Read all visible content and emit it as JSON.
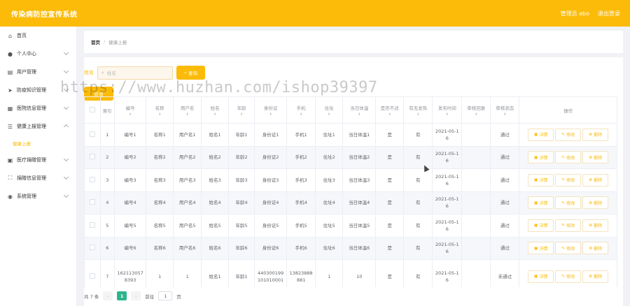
{
  "header": {
    "title": "传染病防控宣传系统",
    "user_label": "管理员 abo",
    "logout_label": "退出登录"
  },
  "sidebar": {
    "items": [
      {
        "label": "首页",
        "icon": "home-icon",
        "has_arrow": false
      },
      {
        "label": "个人中心",
        "icon": "user-icon",
        "has_arrow": true
      },
      {
        "label": "用户管理",
        "icon": "users-icon",
        "has_arrow": true
      },
      {
        "label": "防疫知识管理",
        "icon": "send-icon",
        "has_arrow": true
      },
      {
        "label": "医院信息管理",
        "icon": "grid-icon",
        "has_arrow": true
      },
      {
        "label": "健康上报管理",
        "icon": "list-icon",
        "has_arrow": true,
        "expanded": true
      },
      {
        "label": "医疗捐赠管理",
        "icon": "box-icon",
        "has_arrow": true
      },
      {
        "label": "捐赠信息管理",
        "icon": "frame-icon",
        "has_arrow": true
      },
      {
        "label": "系统管理",
        "icon": "pin-icon",
        "has_arrow": true
      }
    ],
    "subitem": "健康上报"
  },
  "breadcrumb": {
    "home": "首页",
    "current": "健康上报"
  },
  "search": {
    "label": "姓名",
    "placeholder": "姓名",
    "search_button": "查询",
    "add_button": "新增"
  },
  "watermark": "https://www.huzhan.com/ishop39397",
  "table": {
    "columns": [
      "索引",
      "编号",
      "名称",
      "用户名",
      "姓名",
      "年龄",
      "身份证",
      "手机",
      "住址",
      "当日体温",
      "是否不适",
      "有无发热",
      "发布时间",
      "审核回复",
      "审核状态",
      "操作"
    ],
    "rows": [
      {
        "idx": "1",
        "code": "编号1",
        "name": "名称1",
        "username": "用户名1",
        "realname": "姓名1",
        "age": "年龄1",
        "idcard": "身份证1",
        "phone": "手机1",
        "address": "住址1",
        "temp": "当日体温1",
        "unwell": "是",
        "fever": "有",
        "date": "2021-05-16",
        "reply": "",
        "status": "通过"
      },
      {
        "idx": "2",
        "code": "编号2",
        "name": "名称2",
        "username": "用户名2",
        "realname": "姓名2",
        "age": "年龄2",
        "idcard": "身份证2",
        "phone": "手机2",
        "address": "住址2",
        "temp": "当日体温2",
        "unwell": "是",
        "fever": "有",
        "date": "2021-05-16",
        "reply": "",
        "status": "通过"
      },
      {
        "idx": "3",
        "code": "编号3",
        "name": "名称3",
        "username": "用户名3",
        "realname": "姓名3",
        "age": "年龄3",
        "idcard": "身份证3",
        "phone": "手机3",
        "address": "住址3",
        "temp": "当日体温3",
        "unwell": "是",
        "fever": "有",
        "date": "2021-05-16",
        "reply": "",
        "status": "通过"
      },
      {
        "idx": "4",
        "code": "编号4",
        "name": "名称4",
        "username": "用户名4",
        "realname": "姓名4",
        "age": "年龄4",
        "idcard": "身份证4",
        "phone": "手机4",
        "address": "住址4",
        "temp": "当日体温4",
        "unwell": "是",
        "fever": "有",
        "date": "2021-05-16",
        "reply": "",
        "status": "通过"
      },
      {
        "idx": "5",
        "code": "编号5",
        "name": "名称5",
        "username": "用户名5",
        "realname": "姓名5",
        "age": "年龄5",
        "idcard": "身份证5",
        "phone": "手机5",
        "address": "住址5",
        "temp": "当日体温5",
        "unwell": "是",
        "fever": "有",
        "date": "2021-05-16",
        "reply": "",
        "status": "通过"
      },
      {
        "idx": "6",
        "code": "编号6",
        "name": "名称6",
        "username": "用户名6",
        "realname": "姓名6",
        "age": "年龄6",
        "idcard": "身份证6",
        "phone": "手机6",
        "address": "住址6",
        "temp": "当日体温6",
        "unwell": "是",
        "fever": "有",
        "date": "2021-05-16",
        "reply": "",
        "status": "通过"
      },
      {
        "idx": "7",
        "code": "1621130578393",
        "name": "1",
        "username": "1",
        "realname": "姓名1",
        "age": "年龄1",
        "idcard": "440300199101010001",
        "phone": "13823888881",
        "address": "1",
        "temp": "10",
        "unwell": "是",
        "fever": "有",
        "date": "2021-05-16",
        "reply": "",
        "status": "未通过"
      }
    ],
    "actions": {
      "detail": "详情",
      "edit": "修改",
      "delete": "删除"
    }
  },
  "pagination": {
    "total": "共 7 条",
    "current_page": "1",
    "goto_label": "前往",
    "goto_value": "1",
    "page_suffix": "页"
  }
}
